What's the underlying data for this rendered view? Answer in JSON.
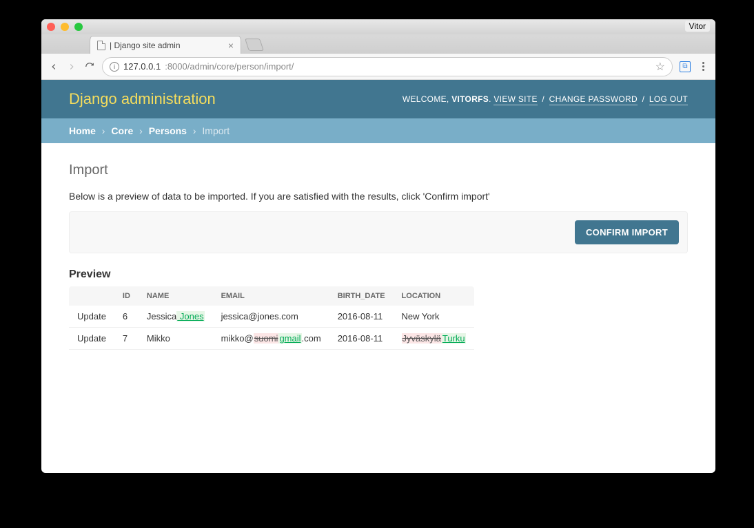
{
  "chrome": {
    "profile": "Vitor",
    "tab_title": "| Django site admin",
    "url_host": "127.0.0.1",
    "url_path": ":8000/admin/core/person/import/"
  },
  "header": {
    "brand": "Django administration",
    "welcome": "WELCOME,",
    "user": "VITORFS",
    "view_site": "VIEW SITE",
    "change_password": "CHANGE PASSWORD",
    "logout": "LOG OUT"
  },
  "breadcrumbs": {
    "home": "Home",
    "app": "Core",
    "model": "Persons",
    "current": "Import"
  },
  "page": {
    "title": "Import",
    "description": "Below is a preview of data to be imported. If you are satisfied with the results, click 'Confirm import'",
    "confirm": "CONFIRM IMPORT",
    "preview_heading": "Preview",
    "columns": {
      "id": "ID",
      "name": "NAME",
      "email": "EMAIL",
      "birth_date": "BIRTH_DATE",
      "location": "LOCATION"
    },
    "rows": [
      {
        "action": "Update",
        "id": "6",
        "name_plain": "Jessica",
        "name_ins": " Jones",
        "email_pre": "jessica@jones.com",
        "birth_date": "2016-08-11",
        "location_plain": "New York"
      },
      {
        "action": "Update",
        "id": "7",
        "name_plain": "Mikko",
        "email_pre": "mikko@",
        "email_del": "suomi",
        "email_ins": "gmail",
        "email_post": ".com",
        "birth_date": "2016-08-11",
        "location_del": "Jyväskylä",
        "location_ins": "Turku"
      }
    ]
  }
}
